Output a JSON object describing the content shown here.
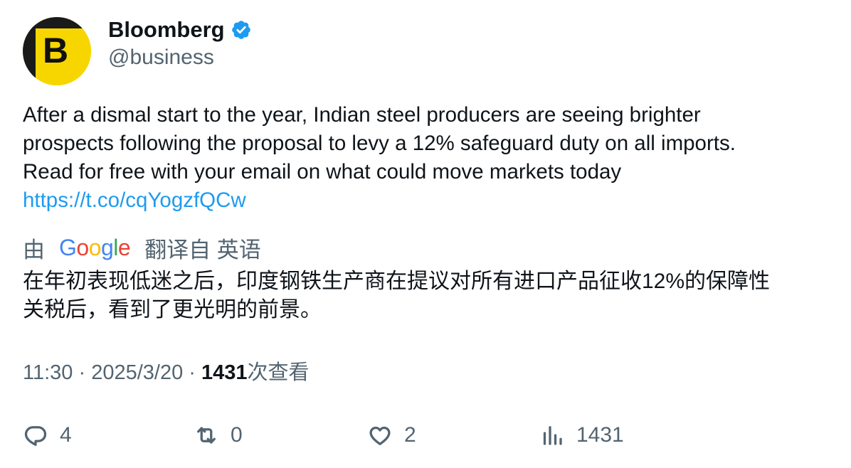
{
  "author": {
    "display_name": "Bloomberg",
    "handle": "@business",
    "avatar_letter": "B",
    "verified": true,
    "verified_color": "#1d9bf0",
    "avatar_color": "#f7d600"
  },
  "tweet": {
    "text_lines": [
      "After a dismal start to the year, Indian steel producers are seeing brighter",
      "prospects following the proposal to levy a 12% safeguard duty on all imports.",
      "Read for free with your email on what could move markets today"
    ],
    "link": "https://t.co/cqYogzfQCw",
    "link_color": "#1d9bf0"
  },
  "translation": {
    "prefix": "由",
    "provider": "Google",
    "suffix": "翻译自 英语",
    "lines": [
      "在年初表现低迷之后，印度钢铁生产商在提议对所有进口产品征收12%的保障性",
      "关税后，看到了更光明的前景。"
    ]
  },
  "meta": {
    "time": "11:30",
    "separator": "·",
    "date": "2025/3/20",
    "views_count": "1431",
    "views_label": "次查看"
  },
  "actions": {
    "reply_icon": "reply-icon",
    "reply_count": "4",
    "retweet_icon": "retweet-icon",
    "retweet_count": "0",
    "like_icon": "heart-icon",
    "like_count": "2",
    "views_icon": "analytics-icon",
    "views_count": "1431"
  }
}
